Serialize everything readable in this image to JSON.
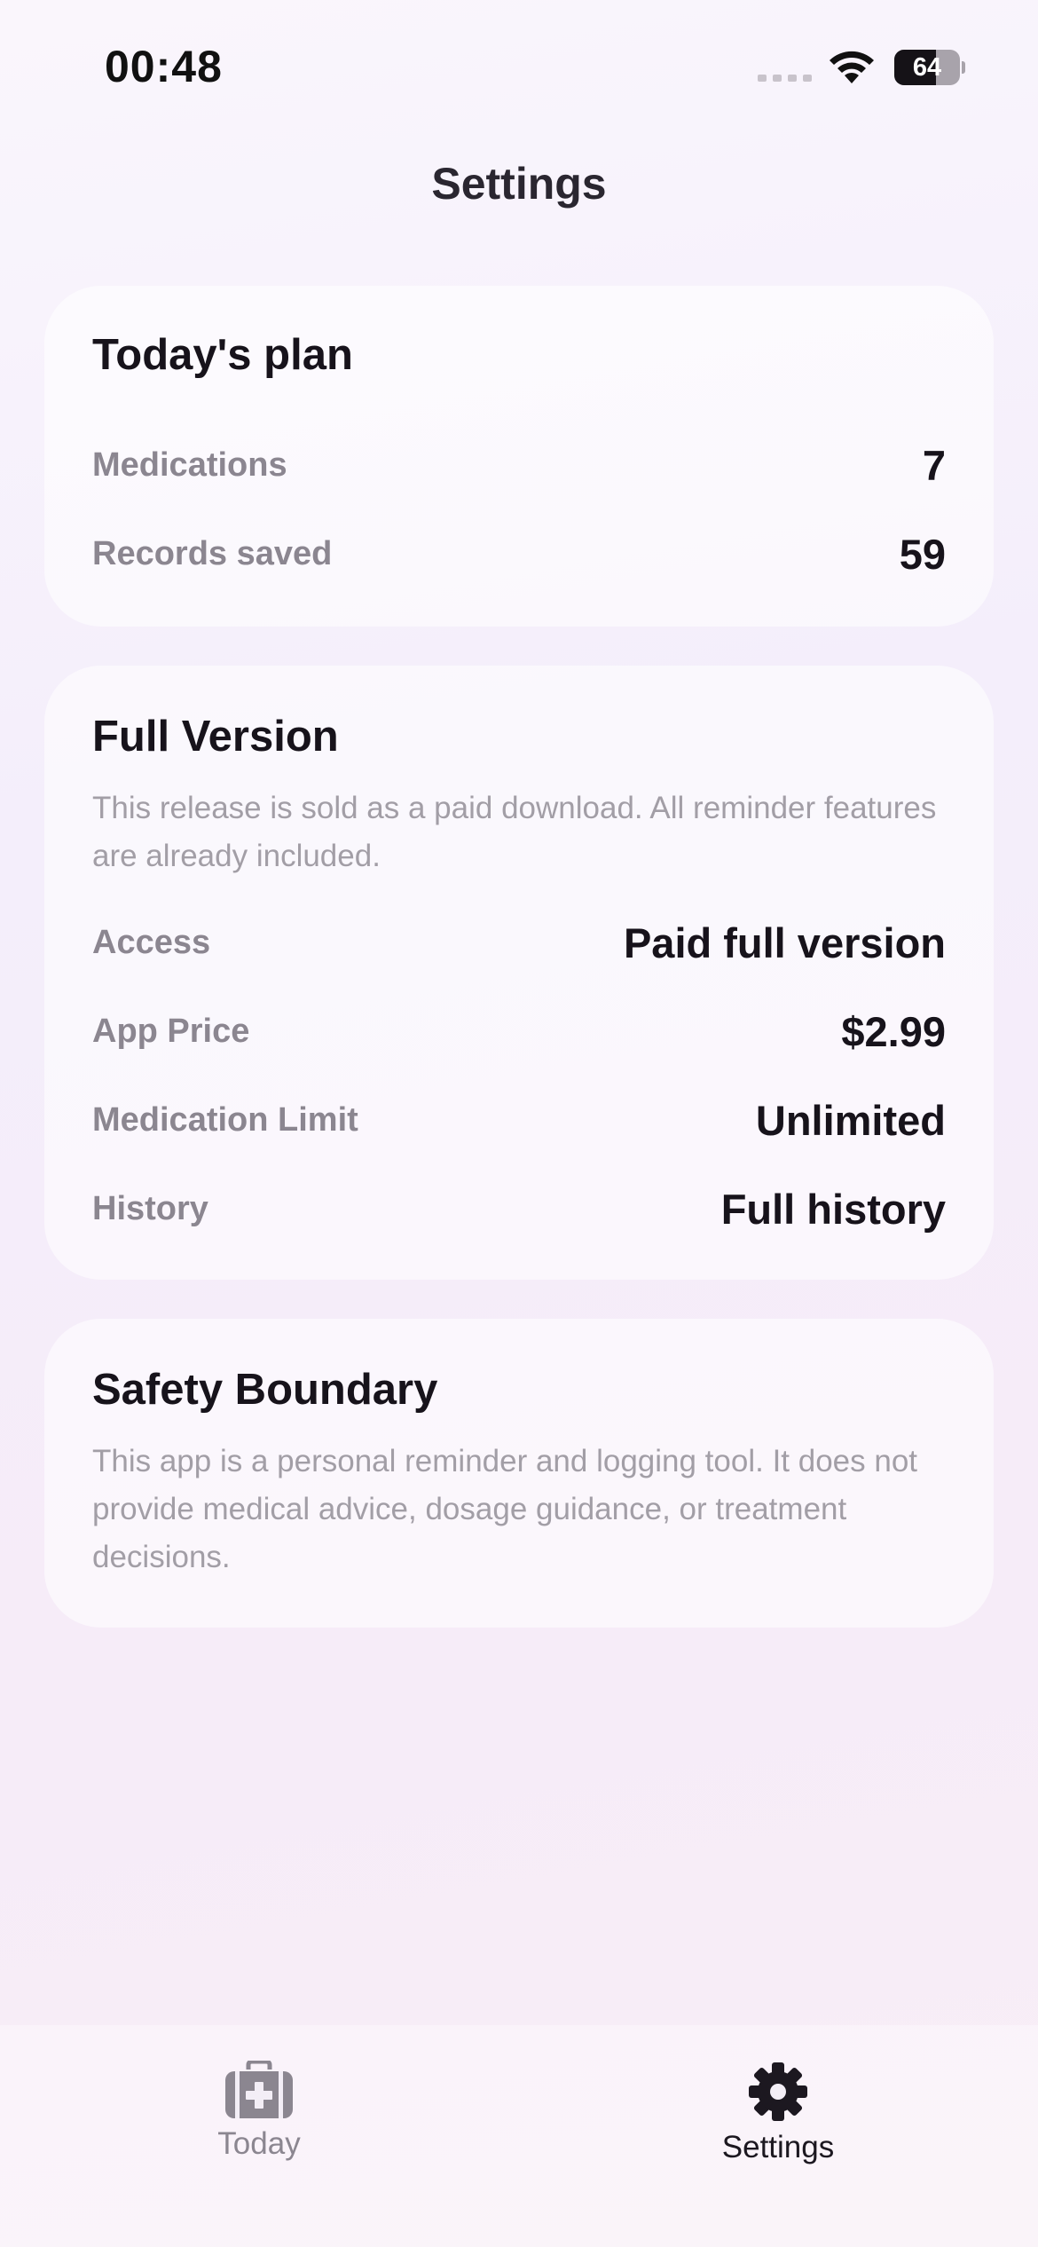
{
  "status_bar": {
    "time": "00:48",
    "battery_percent": "64",
    "battery_level": 0.64
  },
  "nav": {
    "title": "Settings"
  },
  "todays_plan": {
    "title": "Today's plan",
    "rows": [
      {
        "label": "Medications",
        "value": "7"
      },
      {
        "label": "Records saved",
        "value": "59"
      }
    ]
  },
  "full_version": {
    "title": "Full Version",
    "description": "This release is sold as a paid download. All reminder features are already included.",
    "rows": [
      {
        "label": "Access",
        "value": "Paid full version"
      },
      {
        "label": "App Price",
        "value": "$2.99"
      },
      {
        "label": "Medication Limit",
        "value": "Unlimited"
      },
      {
        "label": "History",
        "value": "Full history"
      }
    ]
  },
  "safety": {
    "title": "Safety Boundary",
    "description": "This app is a personal reminder and logging tool. It does not provide medical advice, dosage guidance, or treatment decisions."
  },
  "tab_bar": {
    "tabs": [
      {
        "label": "Today",
        "icon": "medical-kit-icon",
        "active": false
      },
      {
        "label": "Settings",
        "icon": "gear-icon",
        "active": true
      }
    ],
    "active_color": "#1c1820",
    "inactive_color": "#8b8690"
  }
}
